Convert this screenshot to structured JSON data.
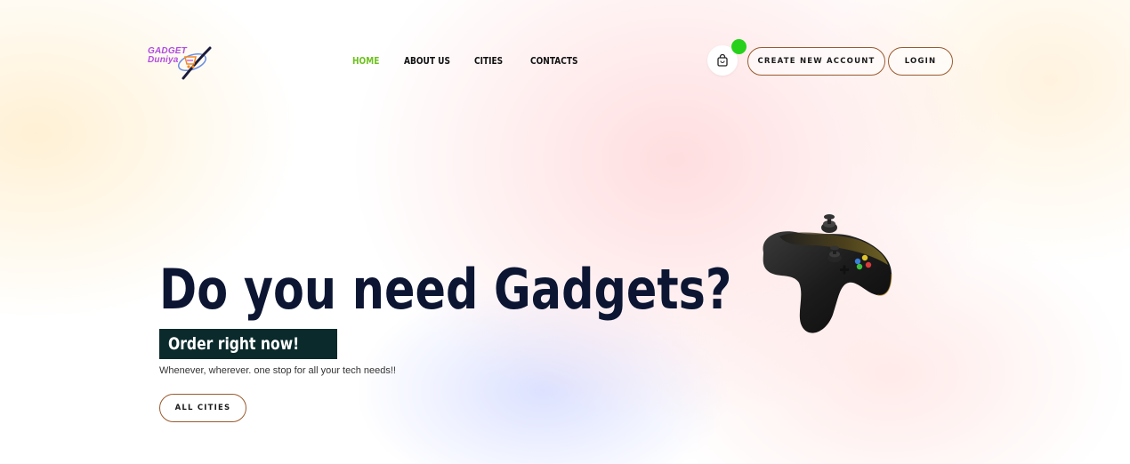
{
  "logo": {
    "line1": "GADGET",
    "line2": "Duniya"
  },
  "nav": {
    "items": [
      {
        "label": "HOME",
        "active": true
      },
      {
        "label": "ABOUT US",
        "active": false
      },
      {
        "label": "CITIES",
        "active": false
      },
      {
        "label": "CONTACTS",
        "active": false
      }
    ]
  },
  "header": {
    "cart_icon": "shopping-bag-icon",
    "create_account_label": "CREATE NEW ACCOUNT",
    "login_label": "LOGIN"
  },
  "hero": {
    "title": "Do you need Gadgets?",
    "tagline": "Order right now!",
    "subtitle": "Whenever, wherever. one stop for all your tech needs!!",
    "button_label": "ALL CITIES"
  },
  "colors": {
    "accent_green": "#6ec21e",
    "badge_green": "#27d11b",
    "title_navy": "#0c1633",
    "tag_bg": "#0a2a2c",
    "button_border": "#9a5a2e"
  }
}
